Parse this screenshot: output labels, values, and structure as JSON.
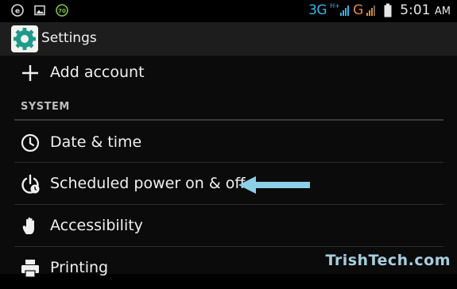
{
  "status_bar": {
    "network_primary": "3G",
    "network_h_plus": "H+",
    "network_secondary": "G",
    "time": "5:01",
    "time_suffix": "AM",
    "notification_icons": [
      "e-icon",
      "image-icon",
      "badge-70-icon"
    ],
    "badge_text": "70"
  },
  "action_bar": {
    "title": "Settings",
    "icon": "settings-gear-icon"
  },
  "items": {
    "add_account": "Add account",
    "section_header": "SYSTEM",
    "date_time": "Date & time",
    "scheduled_power": "Scheduled power on & off",
    "accessibility": "Accessibility",
    "printing": "Printing"
  },
  "watermark": "TrishTech.com",
  "colors": {
    "accent_blue": "#35b5e5",
    "orange": "#e58a3a",
    "arrow_blue": "#8ccfe8",
    "background": "#0b0b0b",
    "action_bar": "#1d1d1d"
  }
}
